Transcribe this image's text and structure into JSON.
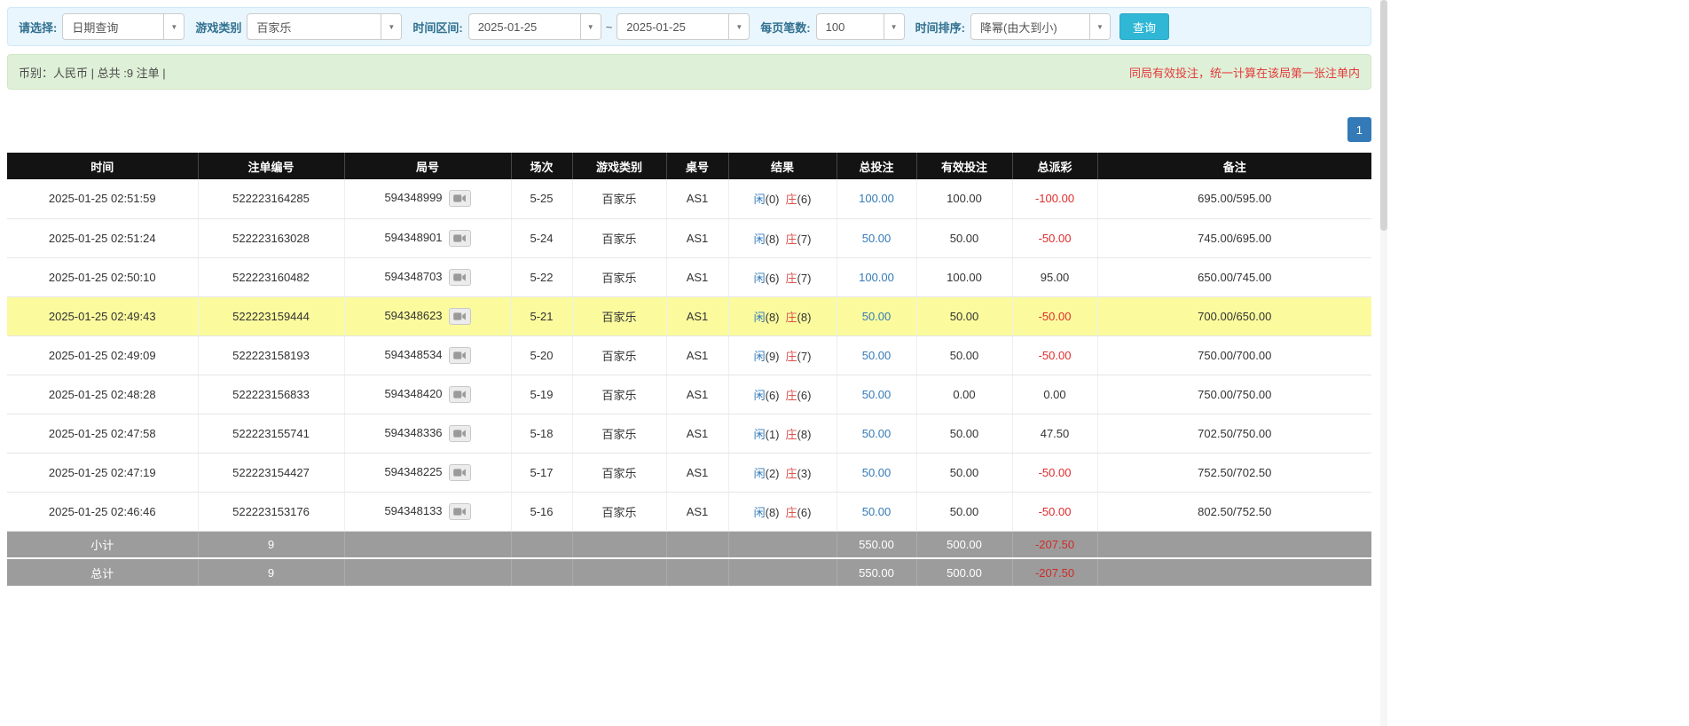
{
  "filters": {
    "select_label": "请选择:",
    "query_type_value": "日期查询",
    "game_category_label": "游戏类别",
    "game_category_value": "百家乐",
    "date_range_label": "时间区间:",
    "date_from_value": "2025-01-25",
    "range_separator": "~",
    "date_to_value": "2025-01-25",
    "page_size_label": "每页笔数:",
    "page_size_value": "100",
    "sort_label": "时间排序:",
    "sort_value": "降幂(由大到小)",
    "search_button_label": "查询"
  },
  "summary_bar": {
    "currency_info": "币别：人民币 | 总共 :9 注单 |",
    "notice": "同局有效投注，统一计算在该局第一张注单内"
  },
  "pagination": {
    "page_1": "1"
  },
  "icons": {
    "combo_caret": "chevron-down-icon",
    "round_icon": "video-replay-icon"
  },
  "colors": {
    "accent_blue": "#337ab7",
    "banker_red": "#d9534f",
    "negative_red": "#e02b2b",
    "highlight_yellow": "#fbfb9e",
    "search_button_cyan": "#30b7d6",
    "header_black": "#131313",
    "footer_gray": "#9c9c9c"
  },
  "table": {
    "headers": [
      "时间",
      "注单编号",
      "局号",
      "场次",
      "游戏类别",
      "桌号",
      "结果",
      "总投注",
      "有效投注",
      "总派彩",
      "备注"
    ],
    "rows": [
      {
        "time": "2025-01-25 02:51:59",
        "bet_id": "522223164285",
        "round_id": "594348999",
        "session": "5-25",
        "game": "百家乐",
        "table_no": "AS1",
        "player_label": "闲",
        "player_score": "(0)",
        "banker_label": "庄",
        "banker_score": "(6)",
        "total_bet": "100.00",
        "valid_bet": "100.00",
        "payout": "-100.00",
        "remark": "695.00/595.00",
        "highlighted": false
      },
      {
        "time": "2025-01-25 02:51:24",
        "bet_id": "522223163028",
        "round_id": "594348901",
        "session": "5-24",
        "game": "百家乐",
        "table_no": "AS1",
        "player_label": "闲",
        "player_score": "(8)",
        "banker_label": "庄",
        "banker_score": "(7)",
        "total_bet": "50.00",
        "valid_bet": "50.00",
        "payout": "-50.00",
        "remark": "745.00/695.00",
        "highlighted": false
      },
      {
        "time": "2025-01-25 02:50:10",
        "bet_id": "522223160482",
        "round_id": "594348703",
        "session": "5-22",
        "game": "百家乐",
        "table_no": "AS1",
        "player_label": "闲",
        "player_score": "(6)",
        "banker_label": "庄",
        "banker_score": "(7)",
        "total_bet": "100.00",
        "valid_bet": "100.00",
        "payout": "95.00",
        "remark": "650.00/745.00",
        "highlighted": false
      },
      {
        "time": "2025-01-25 02:49:43",
        "bet_id": "522223159444",
        "round_id": "594348623",
        "session": "5-21",
        "game": "百家乐",
        "table_no": "AS1",
        "player_label": "闲",
        "player_score": "(8)",
        "banker_label": "庄",
        "banker_score": "(8)",
        "total_bet": "50.00",
        "valid_bet": "50.00",
        "payout": "-50.00",
        "remark": "700.00/650.00",
        "highlighted": true
      },
      {
        "time": "2025-01-25 02:49:09",
        "bet_id": "522223158193",
        "round_id": "594348534",
        "session": "5-20",
        "game": "百家乐",
        "table_no": "AS1",
        "player_label": "闲",
        "player_score": "(9)",
        "banker_label": "庄",
        "banker_score": "(7)",
        "total_bet": "50.00",
        "valid_bet": "50.00",
        "payout": "-50.00",
        "remark": "750.00/700.00",
        "highlighted": false
      },
      {
        "time": "2025-01-25 02:48:28",
        "bet_id": "522223156833",
        "round_id": "594348420",
        "session": "5-19",
        "game": "百家乐",
        "table_no": "AS1",
        "player_label": "闲",
        "player_score": "(6)",
        "banker_label": "庄",
        "banker_score": "(6)",
        "total_bet": "50.00",
        "valid_bet": "0.00",
        "payout": "0.00",
        "remark": "750.00/750.00",
        "highlighted": false
      },
      {
        "time": "2025-01-25 02:47:58",
        "bet_id": "522223155741",
        "round_id": "594348336",
        "session": "5-18",
        "game": "百家乐",
        "table_no": "AS1",
        "player_label": "闲",
        "player_score": "(1)",
        "banker_label": "庄",
        "banker_score": "(8)",
        "total_bet": "50.00",
        "valid_bet": "50.00",
        "payout": "47.50",
        "remark": "702.50/750.00",
        "highlighted": false
      },
      {
        "time": "2025-01-25 02:47:19",
        "bet_id": "522223154427",
        "round_id": "594348225",
        "session": "5-17",
        "game": "百家乐",
        "table_no": "AS1",
        "player_label": "闲",
        "player_score": "(2)",
        "banker_label": "庄",
        "banker_score": "(3)",
        "total_bet": "50.00",
        "valid_bet": "50.00",
        "payout": "-50.00",
        "remark": "752.50/702.50",
        "highlighted": false
      },
      {
        "time": "2025-01-25 02:46:46",
        "bet_id": "522223153176",
        "round_id": "594348133",
        "session": "5-16",
        "game": "百家乐",
        "table_no": "AS1",
        "player_label": "闲",
        "player_score": "(8)",
        "banker_label": "庄",
        "banker_score": "(6)",
        "total_bet": "50.00",
        "valid_bet": "50.00",
        "payout": "-50.00",
        "remark": "802.50/752.50",
        "highlighted": false
      }
    ],
    "subtotal": {
      "label": "小计",
      "count": "9",
      "total_bet": "550.00",
      "valid_bet": "500.00",
      "payout": "-207.50"
    },
    "total": {
      "label": "总计",
      "count": "9",
      "total_bet": "550.00",
      "valid_bet": "500.00",
      "payout": "-207.50"
    }
  }
}
